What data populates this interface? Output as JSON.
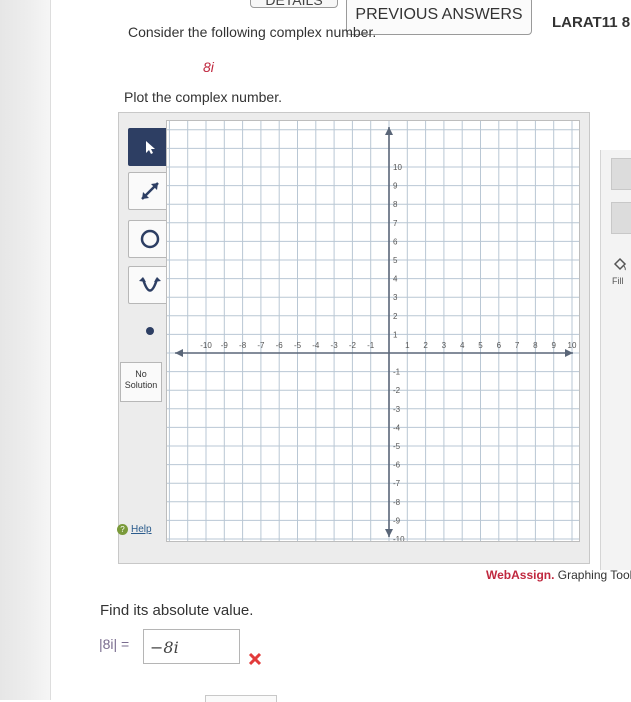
{
  "header": {
    "details_label": "DETAILS",
    "previous_answers_label": "PREVIOUS ANSWERS",
    "course_code": "LARAT11 8"
  },
  "question": {
    "prompt": "Consider the following complex number.",
    "complex_number": "8i",
    "plot_prompt": "Plot the complex number.",
    "absolute_prompt": "Find its absolute value.",
    "abs_label": "|8i| =",
    "abs_answer_value": "−8i",
    "result_icon": "x-mark-icon",
    "result_color": "#e23b3b"
  },
  "graph_tool": {
    "tools": [
      {
        "name": "pointer-tool",
        "icon": "arrow-cursor-icon",
        "active": true
      },
      {
        "name": "line-tool",
        "icon": "diagonal-arrow-icon",
        "active": false
      },
      {
        "name": "circle-tool",
        "icon": "circle-icon",
        "active": false
      },
      {
        "name": "parabola-tool",
        "icon": "parabola-icon",
        "active": false
      },
      {
        "name": "point-tool",
        "icon": "dot-icon",
        "active": false
      }
    ],
    "no_solution_label": "No Solution",
    "help_label": "Help",
    "fill_label": "Fill",
    "brand_name": "WebAssign.",
    "brand_suffix": " Graphing Tool",
    "x_ticks": [
      "-10",
      "-9",
      "-8",
      "-7",
      "-6",
      "-5",
      "-4",
      "-3",
      "-2",
      "-1",
      "1",
      "2",
      "3",
      "4",
      "5",
      "6",
      "7",
      "8",
      "9",
      "10"
    ],
    "y_ticks": [
      "10",
      "9",
      "8",
      "7",
      "6",
      "5",
      "4",
      "3",
      "2",
      "1",
      "-1",
      "-2",
      "-3",
      "-4",
      "-5",
      "-6",
      "-7",
      "-8",
      "-9",
      "-10"
    ],
    "x_range": [
      -10,
      10
    ],
    "y_range": [
      -10,
      10
    ],
    "grid": true,
    "accent_color": "#2d3e63"
  }
}
